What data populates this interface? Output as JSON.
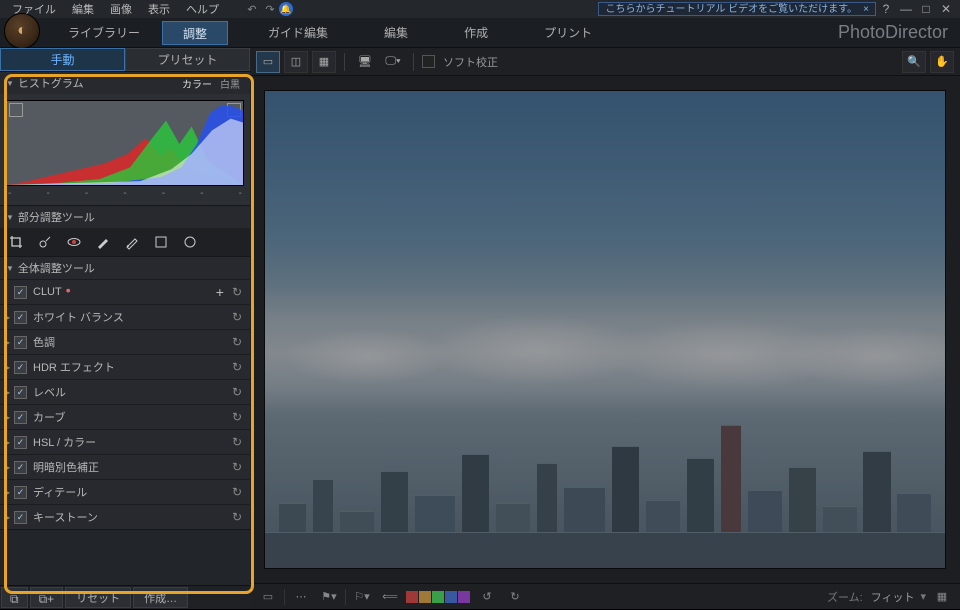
{
  "menu": {
    "file": "ファイル",
    "edit": "編集",
    "image": "画像",
    "view": "表示",
    "help": "ヘルプ"
  },
  "tutorial_banner": "こちらからチュートリアル ビデオをご覧いただけます。",
  "brand": "PhotoDirector",
  "main_tabs": {
    "library": "ライブラリー",
    "adjustment": "調整",
    "guided": "ガイド編集",
    "edit": "編集",
    "create": "作成",
    "print": "プリント"
  },
  "sub_tabs": {
    "manual": "手動",
    "preset": "プリセット"
  },
  "histogram": {
    "title": "ヒストグラム",
    "color": "カラー",
    "bw": "白黒"
  },
  "partial_tools_title": "部分調整ツール",
  "global_tools_title": "全体調整ツール",
  "adj_items": [
    "CLUT",
    "ホワイト バランス",
    "色調",
    "HDR エフェクト",
    "レベル",
    "カーブ",
    "HSL / カラー",
    "明暗別色補正",
    "ディテール",
    "キーストーン"
  ],
  "bottom_buttons": {
    "reset": "リセット",
    "create": "作成…"
  },
  "toolbar": {
    "soft_proof": "ソフト校正"
  },
  "statusbar": {
    "zoom_label": "ズーム:",
    "zoom_value": "フィット"
  },
  "colors": {
    "highlight": "#e8a428"
  }
}
